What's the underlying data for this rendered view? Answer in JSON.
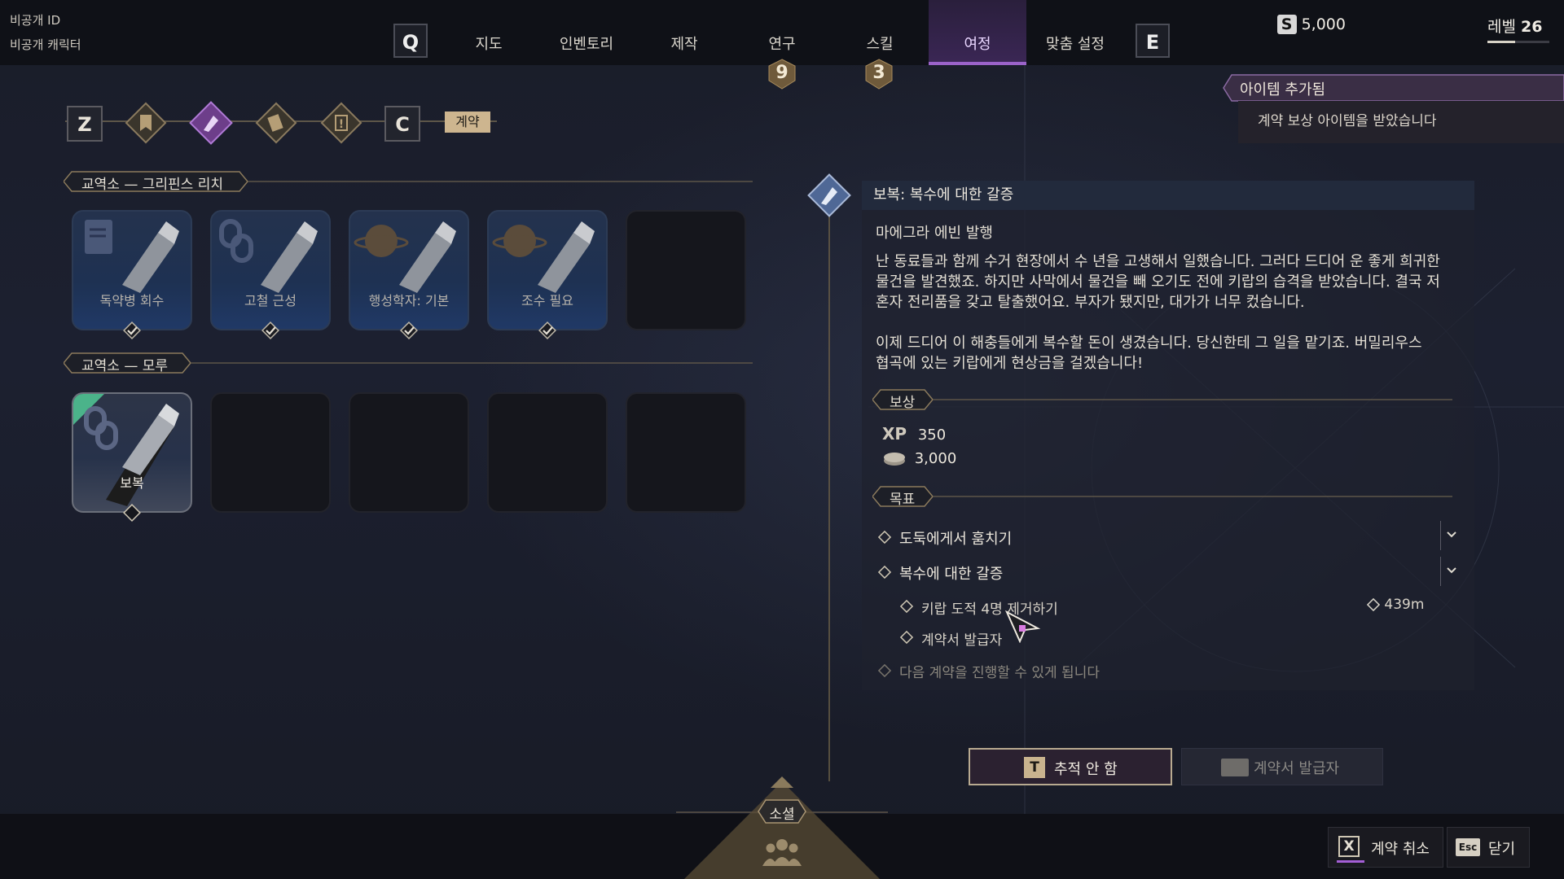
{
  "player": {
    "id_label": "비공개 ID",
    "character_label": "비공개 캐릭터"
  },
  "nav": {
    "key_left": "Q",
    "key_right": "E",
    "tabs": [
      {
        "label": "지도"
      },
      {
        "label": "인벤토리"
      },
      {
        "label": "제작"
      },
      {
        "label": "연구",
        "badge": "9"
      },
      {
        "label": "스킬",
        "badge": "3"
      },
      {
        "label": "여정",
        "active": true
      },
      {
        "label": "맞춤 설정"
      }
    ]
  },
  "status": {
    "currency_icon": "S",
    "currency": "5,000",
    "level_label": "레벨",
    "level": "26",
    "level_progress": 0.45
  },
  "journey_tabs": {
    "key_left": "Z",
    "key_right": "C",
    "active_tab_label": "계약"
  },
  "toast": {
    "title": "아이템 추가됨",
    "message": "계약 보상 아이템을 받았습니다"
  },
  "sections": [
    {
      "title": "교역소 — 그리핀스 리치",
      "cards": [
        {
          "label": "독약병 회수",
          "icon": "document-icon",
          "completed": true
        },
        {
          "label": "고철 근성",
          "icon": "chain-link-icon",
          "completed": true
        },
        {
          "label": "행성학자: 기본",
          "icon": "planet-icon",
          "completed": true
        },
        {
          "label": "조수 필요",
          "icon": "planet-icon",
          "completed": true
        },
        {
          "empty": true
        }
      ]
    },
    {
      "title": "교역소 — 모루",
      "cards": [
        {
          "label": "보복",
          "icon": "chain-link-icon",
          "selected": true,
          "new": true
        },
        {
          "empty": true
        },
        {
          "empty": true
        },
        {
          "empty": true
        },
        {
          "empty": true
        }
      ]
    }
  ],
  "detail": {
    "title": "보복: 복수에 대한 갈증",
    "issuer": "마에그라 에빈 발행",
    "paragraph1": [
      "난 동료들과 함께 수거 현장에서 수 년을 고생해서 일했습니다. 그러다 드디어 운 좋게 희귀한",
      "물건을 발견했죠. 하지만 사막에서 물건을 빼 오기도 전에 키랍의 습격을 받았습니다. 결국 저",
      "혼자 전리품을 갖고 탈출했어요. 부자가 됐지만, 대가가 너무 컸습니다."
    ],
    "paragraph2": [
      "이제 드디어 이 해충들에게 복수할 돈이 생겼습니다. 당신한테 그 일을 맡기죠. 버밀리우스",
      "협곡에 있는 키랍에게 현상금을 걸겠습니다!"
    ],
    "rewards_label": "보상",
    "rewards": {
      "xp_label": "XP",
      "xp": "350",
      "credits": "3,000"
    },
    "objectives_label": "목표",
    "objectives": [
      {
        "label": "도둑에게서 훔치기"
      },
      {
        "label": "복수에 대한 갈증",
        "subs": [
          {
            "label": "키랍 도적 4명 제거하기",
            "distance": "439m"
          },
          {
            "label": "계약서 발급자"
          }
        ]
      }
    ],
    "next_note": "다음 계약을 진행할 수 있게 됩니다"
  },
  "buttons": {
    "track_key": "T",
    "track_label": "추적 안 함",
    "issuer_label": "계약서 발급자",
    "cancel_key": "X",
    "cancel_label": "계약 취소",
    "close_key": "Esc",
    "close_label": "닫기"
  },
  "footer": {
    "center_label": "소셜"
  }
}
